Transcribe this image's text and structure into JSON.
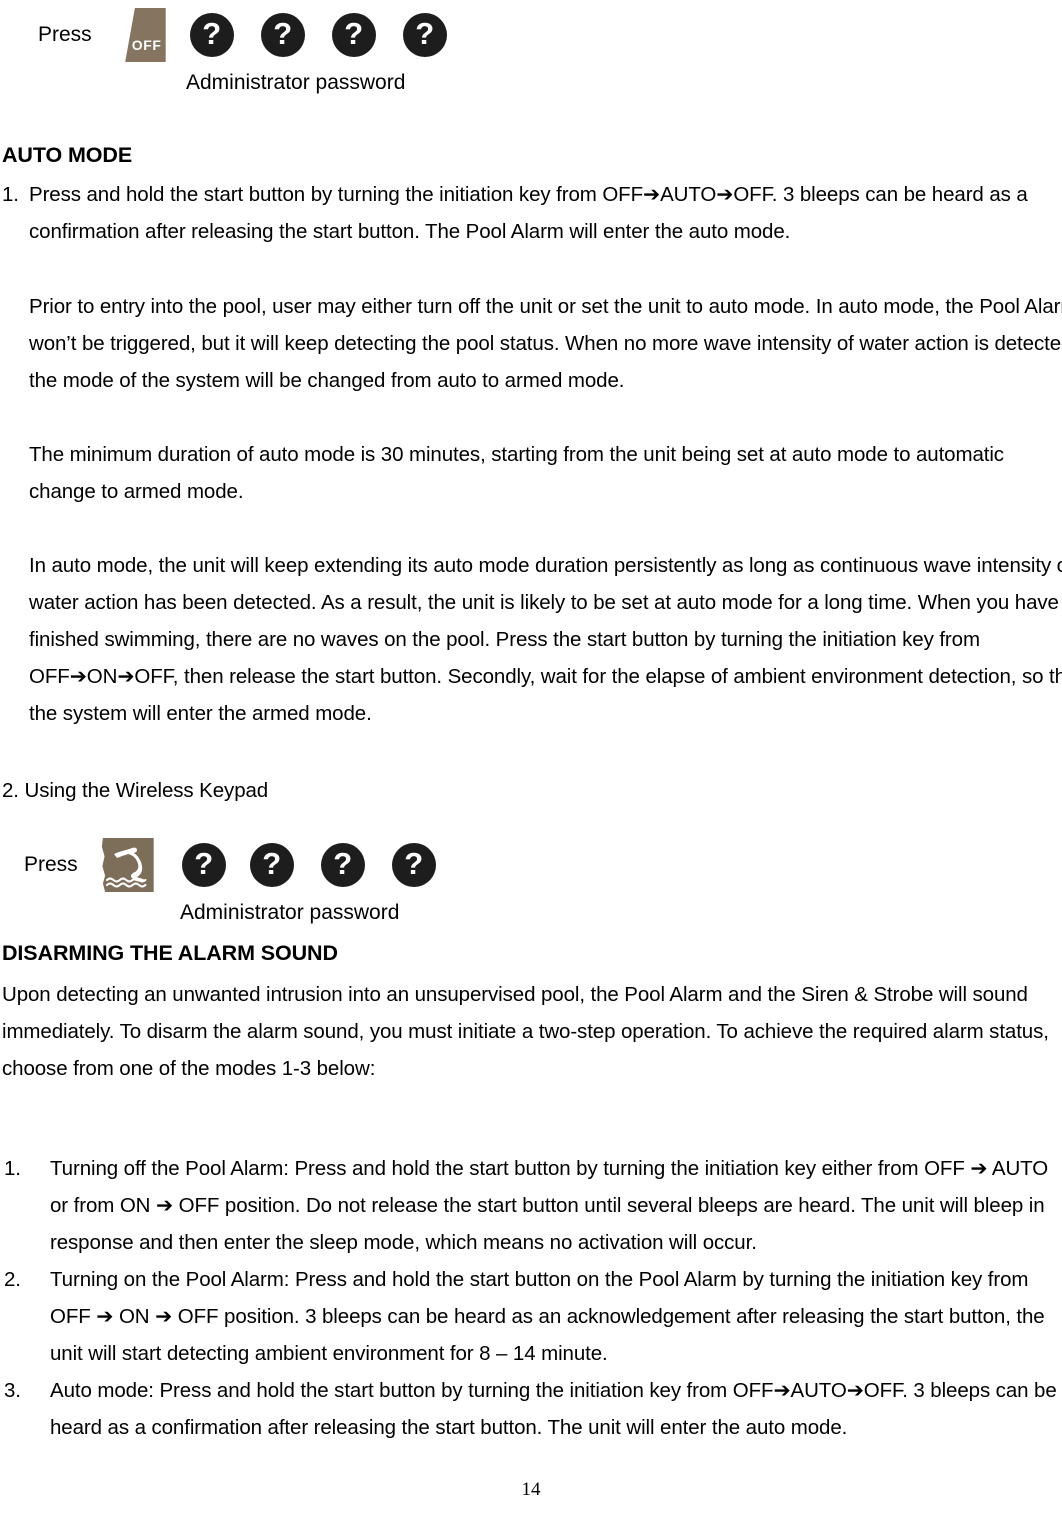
{
  "document": {
    "page_number": "14"
  },
  "top_block": {
    "press_label": "Press",
    "key_icon": "off-key-icon",
    "key_icon_text": "OFF",
    "password_digits": [
      "?",
      "?",
      "?",
      "?"
    ],
    "caption": "Administrator password"
  },
  "auto_mode": {
    "heading": "AUTO MODE",
    "item1_marker": "1.",
    "item1_text": "Press and hold the start button by turning the initiation key from OFF➔AUTO➔OFF. 3 bleeps can be heard as a confirmation after releasing the start button. The Pool Alarm will enter the auto mode.",
    "para1": "Prior to entry into the pool, user may either turn off the unit or set the unit to auto mode. In auto mode, the Pool Alarm won’t be triggered, but it will keep detecting the pool status. When no more wave intensity of water action is detected, the mode of the system will be changed from auto to armed mode.",
    "para2": "The minimum duration of auto mode is 30 minutes, starting from the unit being set at auto mode to automatic change to armed mode.",
    "para3": "In auto mode, the unit will keep extending its auto mode duration persistently as long as continuous wave intensity of water action has been detected. As a result, the unit is likely to be set at auto mode for a long time. When you have finished swimming, there are no waves on the pool. Press the start button by turning the initiation key from OFF➔ON➔OFF, then release the start button. Secondly, wait for the elapse of ambient environment detection, so that the system will enter the armed mode.",
    "item2_text": "2. Using the Wireless Keypad"
  },
  "keypad_block": {
    "press_label": "Press",
    "key_icon": "diver-pool-icon",
    "password_digits": [
      "?",
      "?",
      "?",
      "?"
    ],
    "caption": "Administrator password"
  },
  "disarming": {
    "heading": "DISARMING THE ALARM SOUND",
    "intro": "Upon detecting an unwanted intrusion into an unsupervised pool, the Pool Alarm and the Siren & Strobe will sound immediately. To disarm the alarm sound, you must initiate a two-step operation. To achieve the required alarm status, choose from one of the modes 1-3 below:",
    "items": [
      {
        "marker": "1.",
        "text": "Turning off the Pool Alarm: Press and hold the start button by turning the initiation key either from OFF ➔ AUTO or from ON ➔ OFF position.    Do not release the start button until several bleeps are heard. The unit will bleep in response and then enter the sleep mode, which means no activation will occur."
      },
      {
        "marker": "2.",
        "text": "Turning on the Pool Alarm: Press and hold the start button on the Pool Alarm by turning the initiation key from OFF ➔ ON ➔ OFF position. 3 bleeps can be heard as an acknowledgement after releasing the start button, the unit will start detecting ambient environment for 8 – 14 minute."
      },
      {
        "marker": "3.",
        "text": " Auto mode: Press and hold the start button by turning the initiation key from OFF➔AUTO➔OFF. 3 bleeps can be heard as a confirmation after releasing the start button. The unit will enter the auto mode."
      }
    ]
  },
  "colors": {
    "key_icon_bg": "#857560",
    "question_circle_bg": "#1d1d1d",
    "text": "#000000"
  }
}
